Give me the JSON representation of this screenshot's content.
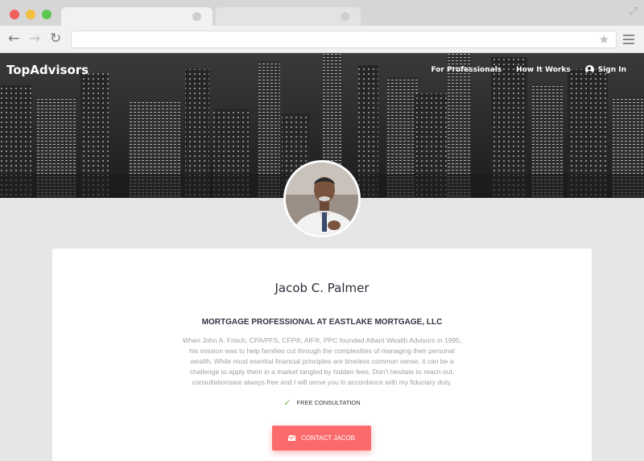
{
  "browser": {
    "back_icon": "arrow-left-icon",
    "forward_icon": "arrow-right-icon",
    "reload_icon": "reload-icon",
    "address_value": "",
    "star_icon": "star-icon",
    "menu_icon": "hamburger-icon"
  },
  "header": {
    "brand": "TopAdvisors",
    "nav": {
      "for_professionals": "For Professionals",
      "how_it_works": "How It Works",
      "sign_in": "Sign In"
    }
  },
  "profile": {
    "name": "Jacob C. Palmer",
    "title": "MORTGAGE PROFESSIONAL AT EASTLAKE MORTGAGE, LLC",
    "bio": "When John A. Frisch, CPA/PFS, CFP®, AIF®, PPC founded Alliant Wealth Advisors in 1995, his mission was to help families cut through the complexities of managing their personal wealth. While most esential financial principles are timeless common sense, it can be a challenge to apply them in a market tangled by hidden fees. Don't hesitate to reach out, consultationsare always free and I will serve you in accordance with my fiduciary duty.",
    "consultation": "FREE CONSULTATION",
    "contact_button": "CONTACT JACOB"
  },
  "colors": {
    "accent": "#fb6b6b",
    "check": "#7ab648",
    "text_dark": "#2c2c3a",
    "text_muted": "#a0a0a0"
  }
}
